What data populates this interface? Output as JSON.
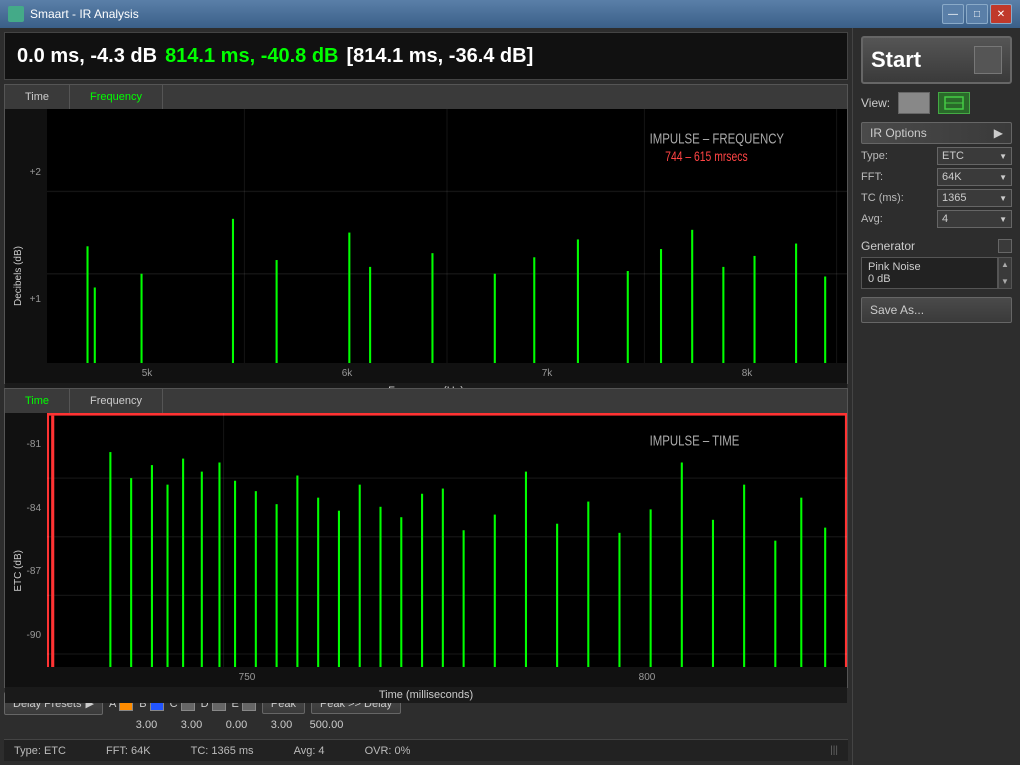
{
  "window": {
    "title": "Smaart - IR Analysis",
    "buttons": {
      "minimize": "—",
      "maximize": "□",
      "close": "✕"
    }
  },
  "header": {
    "value1_white": "0.0 ms, -4.3 dB",
    "value2_green": "814.1 ms, -40.8 dB",
    "value3_bracket": "[814.1 ms, -36.4 dB]"
  },
  "freq_chart": {
    "tabs": [
      "Time",
      "Frequency"
    ],
    "active_tab": "Frequency",
    "y_labels": [
      "+2",
      "+1"
    ],
    "x_labels": [
      "5k",
      "6k",
      "7k",
      "8k"
    ],
    "x_axis_title": "Frequency (Hz)",
    "y_axis_title": "Decibels (dB)",
    "chart_label": "IMPULSE – FREQUENCY",
    "chart_sublabel": "744 – 615 mrsecs"
  },
  "time_chart": {
    "tabs": [
      "Time",
      "Frequency"
    ],
    "active_tab": "Time",
    "y_labels": [
      "-81",
      "-84",
      "-87",
      "-90"
    ],
    "x_labels": [
      "750",
      "800"
    ],
    "x_axis_title": "Time (milliseconds)",
    "y_axis_title": "ETC (dB)",
    "chart_label": "IMPULSE – TIME"
  },
  "bottom_controls": {
    "delay_presets_label": "Delay Presets",
    "arrow": "▶",
    "presets": [
      {
        "label": "A",
        "color": "#ff8c00",
        "value": "3.00"
      },
      {
        "label": "B",
        "color": "#2255ff",
        "value": "3.00"
      },
      {
        "label": "C",
        "color": "#888888",
        "value": "0.00"
      },
      {
        "label": "D",
        "color": "#888888",
        "value": "3.00"
      },
      {
        "label": "E",
        "color": "#888888",
        "value": "500.00"
      }
    ],
    "peak_btn": "Peak",
    "peak_delay_btn": "Peak >> Delay"
  },
  "status_bar": {
    "type": "Type: ETC",
    "fft": "FFT: 64K",
    "tc": "TC: 1365 ms",
    "avg": "Avg: 4",
    "ovr": "OVR: 0%"
  },
  "right_panel": {
    "start_label": "Start",
    "view_label": "View:",
    "ir_options_label": "IR Options",
    "ir_options_arrow": "▶",
    "options": [
      {
        "label": "Type:",
        "value": "ETC"
      },
      {
        "label": "FFT:",
        "value": "64K"
      },
      {
        "label": "TC (ms):",
        "value": "1365"
      },
      {
        "label": "Avg:",
        "value": "4"
      }
    ],
    "generator_label": "Generator",
    "generator_value": "Pink Noise",
    "generator_db": "0 dB",
    "save_btn": "Save As..."
  }
}
